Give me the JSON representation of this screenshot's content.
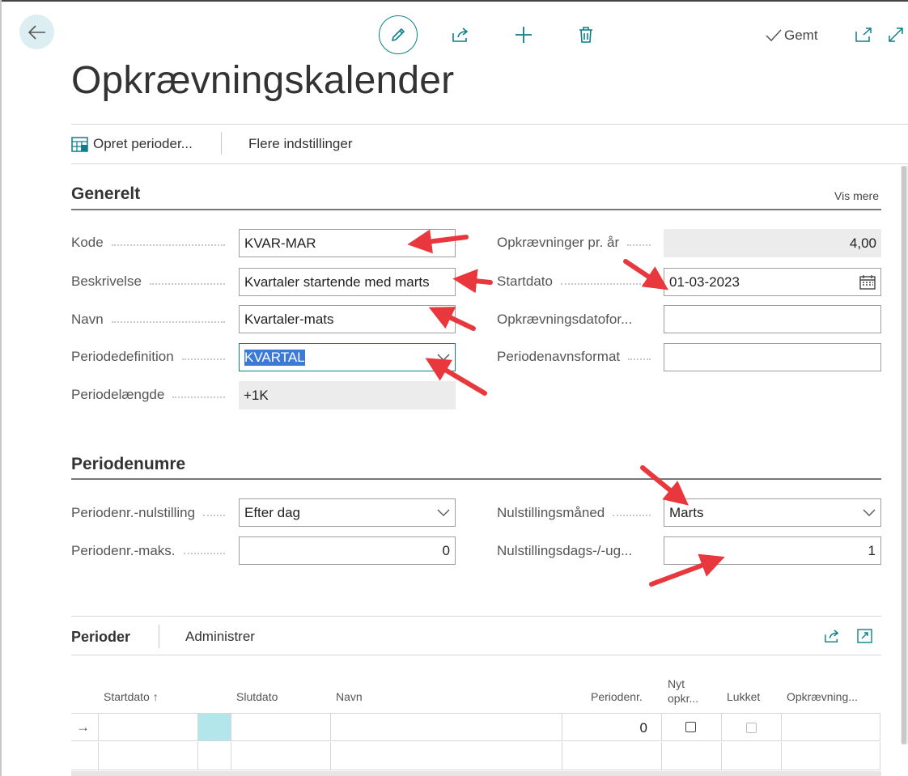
{
  "toolbar": {
    "saved_label": "Gemt"
  },
  "page": {
    "title": "Opkrævningskalender"
  },
  "actions": {
    "create_periods": "Opret perioder...",
    "more_settings": "Flere indstillinger"
  },
  "general": {
    "title": "Generelt",
    "show_more": "Vis mere",
    "code_label": "Kode",
    "code_value": "KVAR-MAR",
    "description_label": "Beskrivelse",
    "description_value": "Kvartaler startende med marts",
    "name_label": "Navn",
    "name_value": "Kvartaler-mats",
    "period_def_label": "Periodedefinition",
    "period_def_value": "KVARTAL",
    "period_length_label": "Periodelængde",
    "period_length_value": "+1K",
    "per_year_label": "Opkrævninger pr. år",
    "per_year_value": "4,00",
    "start_date_label": "Startdato",
    "start_date_value": "01-03-2023",
    "date_format_label": "Opkrævningsdatofor...",
    "date_format_value": "",
    "period_name_format_label": "Periodenavnsformat",
    "period_name_format_value": ""
  },
  "period_numbers": {
    "title": "Periodenumre",
    "reset_label": "Periodenr.-nulstilling",
    "reset_value": "Efter dag",
    "max_label": "Periodenr.-maks.",
    "max_value": "0",
    "reset_month_label": "Nulstillingsmåned",
    "reset_month_value": "Marts",
    "reset_day_label": "Nulstillingsdags-/-ug...",
    "reset_day_value": "1"
  },
  "periods": {
    "tab_label": "Perioder",
    "manage_label": "Administrer",
    "columns": {
      "start_date": "Startdato",
      "sort_indicator": "↑",
      "end_date": "Slutdato",
      "name": "Navn",
      "period_no": "Periodenr.",
      "new_charge_line1": "Nyt",
      "new_charge_line2": "opkr...",
      "closed": "Lukket",
      "charge": "Opkrævning..."
    },
    "rows": [
      {
        "marker": "→",
        "start_date": "",
        "end_date": "",
        "name": "",
        "period_no": "0",
        "new_charge": false,
        "closed": false,
        "charge": ""
      }
    ]
  },
  "colors": {
    "accent": "#0b7f8a",
    "annotation_arrow": "#e8383d",
    "selection": "#3b7bd6"
  },
  "icons": [
    "back-arrow-icon",
    "pencil-icon",
    "share-icon",
    "plus-icon",
    "trash-icon",
    "checkmark-icon",
    "open-new-window-icon",
    "expand-icon",
    "table-settings-icon",
    "chevron-down-icon",
    "calendar-icon",
    "row-arrow-icon"
  ]
}
